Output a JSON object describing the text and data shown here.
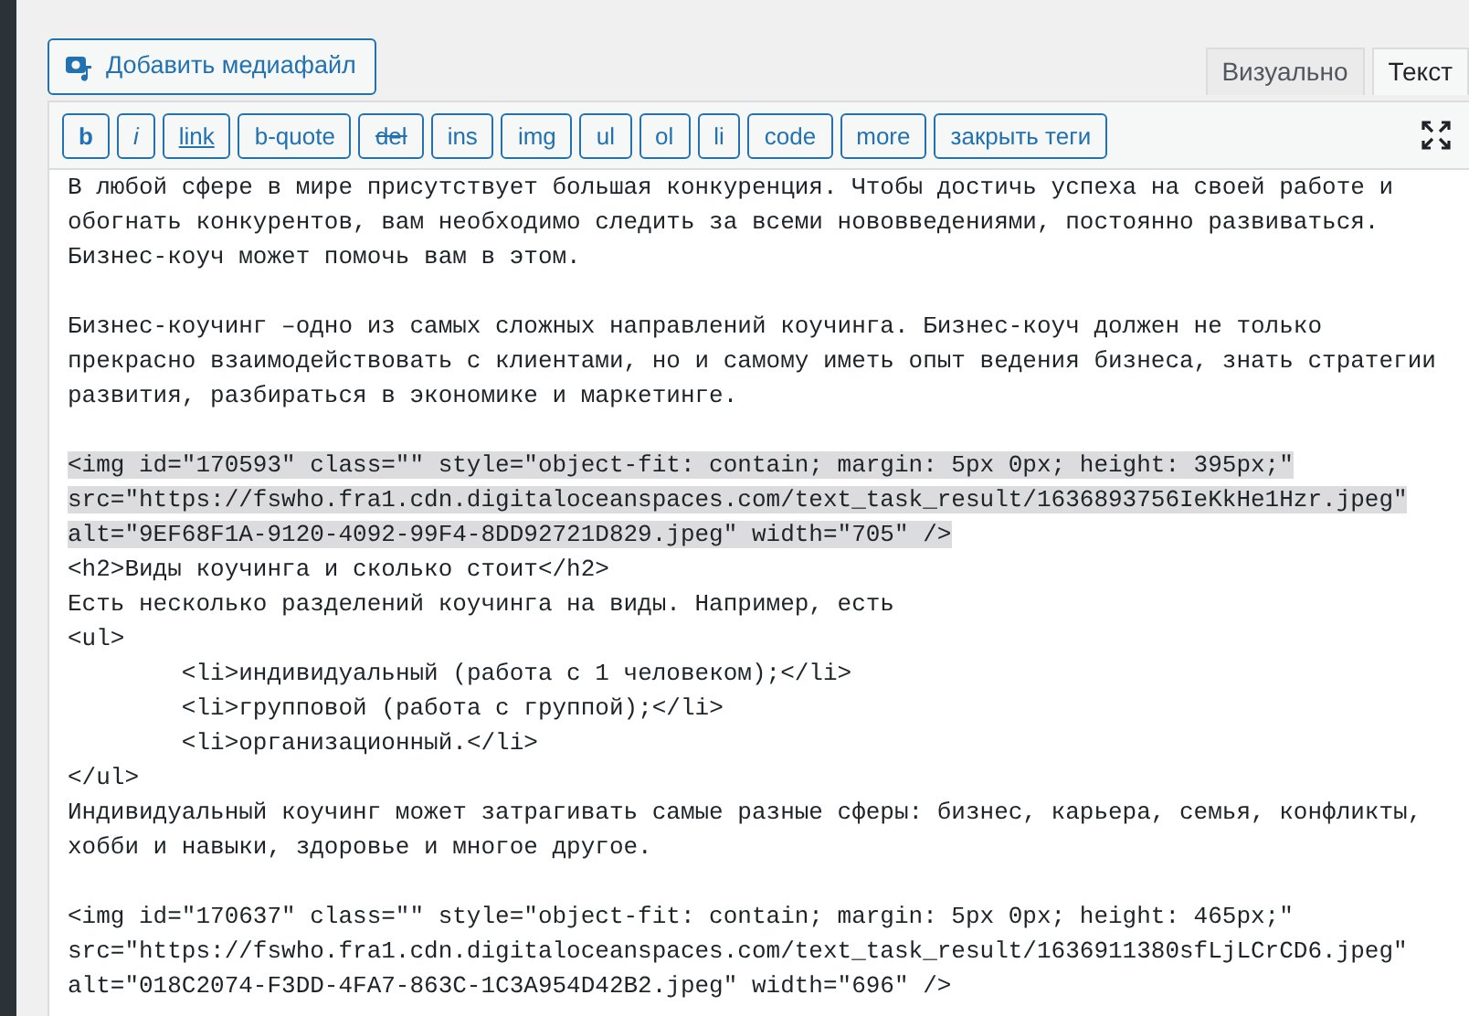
{
  "add_media_button": {
    "label": "Добавить медиафайл"
  },
  "tabs": [
    {
      "label": "Визуально",
      "selected": false
    },
    {
      "label": "Текст",
      "selected": true
    }
  ],
  "toolbar": [
    {
      "label": "b",
      "kind": "bold"
    },
    {
      "label": "i",
      "kind": "italic"
    },
    {
      "label": "link",
      "kind": "underline"
    },
    {
      "label": "b-quote",
      "kind": "plain"
    },
    {
      "label": "del",
      "kind": "strike"
    },
    {
      "label": "ins",
      "kind": "plain"
    },
    {
      "label": "img",
      "kind": "plain"
    },
    {
      "label": "ul",
      "kind": "plain"
    },
    {
      "label": "ol",
      "kind": "plain"
    },
    {
      "label": "li",
      "kind": "plain"
    },
    {
      "label": "code",
      "kind": "plain"
    },
    {
      "label": "more",
      "kind": "plain"
    },
    {
      "label": "закрыть теги",
      "kind": "plain"
    }
  ],
  "editor_lines": [
    {
      "kind": "text",
      "text": "В любой сфере в мире присутствует большая конкуренция. Чтобы достичь успеха на своей работе и",
      "selected": false
    },
    {
      "kind": "text",
      "text": "обогнать конкурентов, вам необходимо следить за всеми нововведениями, постоянно развиваться.",
      "selected": false
    },
    {
      "kind": "text",
      "text": "Бизнес-коуч может помочь вам в этом.",
      "selected": false
    },
    {
      "kind": "blank"
    },
    {
      "kind": "text",
      "text": "Бизнес-коучинг –одно из самых сложных направлений коучинга. Бизнес-коуч должен не только",
      "selected": false
    },
    {
      "kind": "text",
      "text": "прекрасно взаимодействовать с клиентами, но и самому иметь опыт ведения бизнеса, знать стратегии",
      "selected": false
    },
    {
      "kind": "text",
      "text": "развития, разбираться в экономике и маркетинге.",
      "selected": false
    },
    {
      "kind": "blank"
    },
    {
      "kind": "text",
      "text": "<img id=\"170593\" class=\"\" style=\"object-fit: contain; margin: 5px 0px; height: 395px;\"",
      "selected": true
    },
    {
      "kind": "text",
      "text": "src=\"https://fswho.fra1.cdn.digitaloceanspaces.com/text_task_result/1636893756IeKkHe1Hzr.jpeg\"",
      "selected": true
    },
    {
      "kind": "text",
      "text": "alt=\"9EF68F1A-9120-4092-99F4-8DD92721D829.jpeg\" width=\"705\" />",
      "selected": true
    },
    {
      "kind": "text",
      "text": "<h2>Виды коучинга и сколько стоит</h2>",
      "selected": false
    },
    {
      "kind": "text",
      "text": "Есть несколько разделений коучинга на виды. Например, есть",
      "selected": false
    },
    {
      "kind": "text",
      "text": "<ul>",
      "selected": false
    },
    {
      "kind": "text",
      "text": "\t<li>индивидуальный (работа с 1 человеком);</li>",
      "selected": false
    },
    {
      "kind": "text",
      "text": "\t<li>групповой (работа с группой);</li>",
      "selected": false
    },
    {
      "kind": "text",
      "text": "\t<li>организационный.</li>",
      "selected": false
    },
    {
      "kind": "text",
      "text": "</ul>",
      "selected": false
    },
    {
      "kind": "text",
      "text": "Индивидуальный коучинг может затрагивать самые разные сферы: бизнес, карьера, семья, конфликты,",
      "selected": false
    },
    {
      "kind": "text",
      "text": "хобби и навыки, здоровье и многое другое.",
      "selected": false
    },
    {
      "kind": "blank"
    },
    {
      "kind": "text",
      "text": "<img id=\"170637\" class=\"\" style=\"object-fit: contain; margin: 5px 0px; height: 465px;\"",
      "selected": false
    },
    {
      "kind": "text",
      "text": "src=\"https://fswho.fra1.cdn.digitaloceanspaces.com/text_task_result/1636911380sfLjLCrCD6.jpeg\"",
      "selected": false
    },
    {
      "kind": "text",
      "text": "alt=\"018C2074-F3DD-4FA7-863C-1C3A954D42B2.jpeg\" width=\"696\" />",
      "selected": false
    }
  ]
}
